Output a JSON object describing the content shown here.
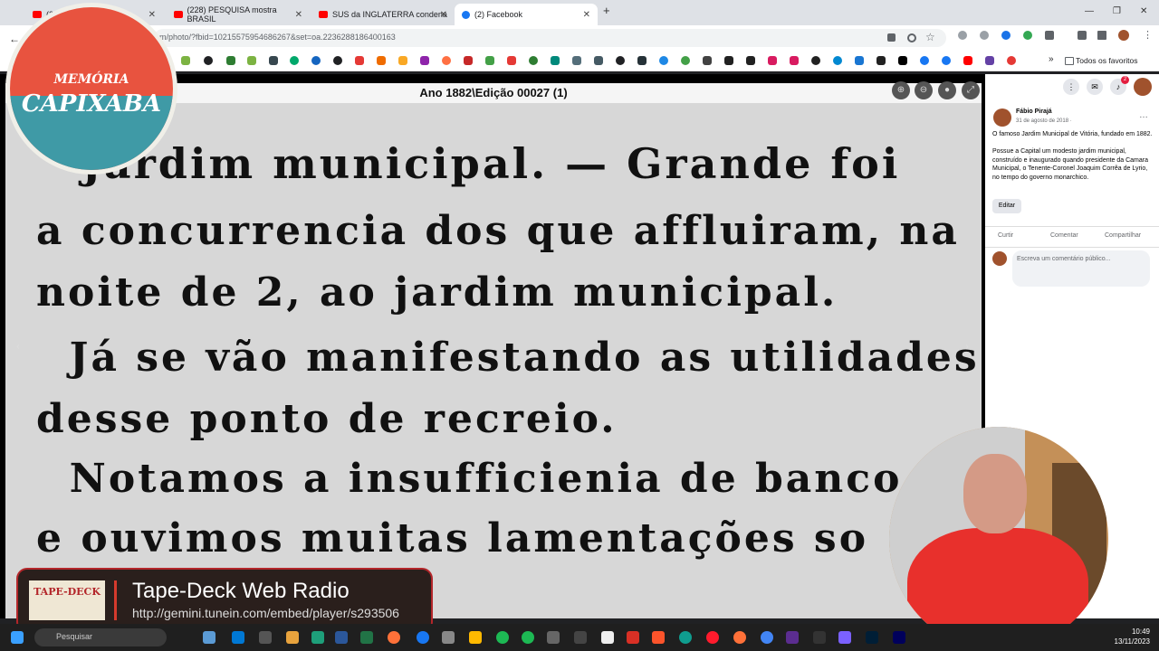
{
  "browser": {
    "tabs": [
      {
        "label": "(22",
        "icon": "youtube-icon"
      },
      {
        "label": "(228) PESQUISA mostra BRASIL",
        "icon": "youtube-icon"
      },
      {
        "label": "SUS da INGLATERRA condena",
        "icon": "youtube-icon"
      },
      {
        "label": "(2) Facebook",
        "icon": "facebook-icon",
        "active": true
      }
    ],
    "url": "m/photo/?fbid=10215575954686267&set=oa.2236288186400163",
    "favorites_label": "Todos os favoritos"
  },
  "viewer": {
    "title": "Ano 1882\\Edição 00027 (1)",
    "newspaper_lines": [
      "Jardim municipal. — Grande foi",
      "a concurrencia dos que affluiram, na",
      "noite de 2, ao jardim municipal.",
      "  Já se vão manifestando as utilidades",
      "desse ponto de recreio.",
      "  Notamos a insufficienia de banco",
      "e ouvimos muitas lamentações so"
    ]
  },
  "logo": {
    "line1": "MEMÓRIA",
    "line2": "CAPIXABA"
  },
  "facebook": {
    "author": "Fábio Pirajá",
    "date": "31 de agosto de 2018 · ",
    "post": "O famoso Jardim Municipal de Vitória, fundado em 1882.\n\nPossue a Capital um modesto jardim municipal, construído e inaugurado quando presidente da Camara Municipal, o Tenente-Coronel Joaquim Corrêa de Lyrio, no tempo do governo monarchico.",
    "edit_label": "Editar",
    "actions": {
      "like": "Curtir",
      "comment": "Comentar",
      "share": "Compartilhar"
    },
    "comment_placeholder": "Escreva um comentário público...",
    "notification_count": "2"
  },
  "radio": {
    "logo_text": "TAPE-DECK",
    "name": "Tape-Deck Web Radio",
    "url": "http://gemini.tunein.com/embed/player/s293506"
  },
  "taskbar": {
    "search_label": "Pesquisar",
    "time": "10:49",
    "date": "13/11/2023"
  },
  "colors": {
    "accent_red": "#e8533f",
    "teal": "#3f9aa6",
    "facebook_blue": "#1877f2"
  }
}
